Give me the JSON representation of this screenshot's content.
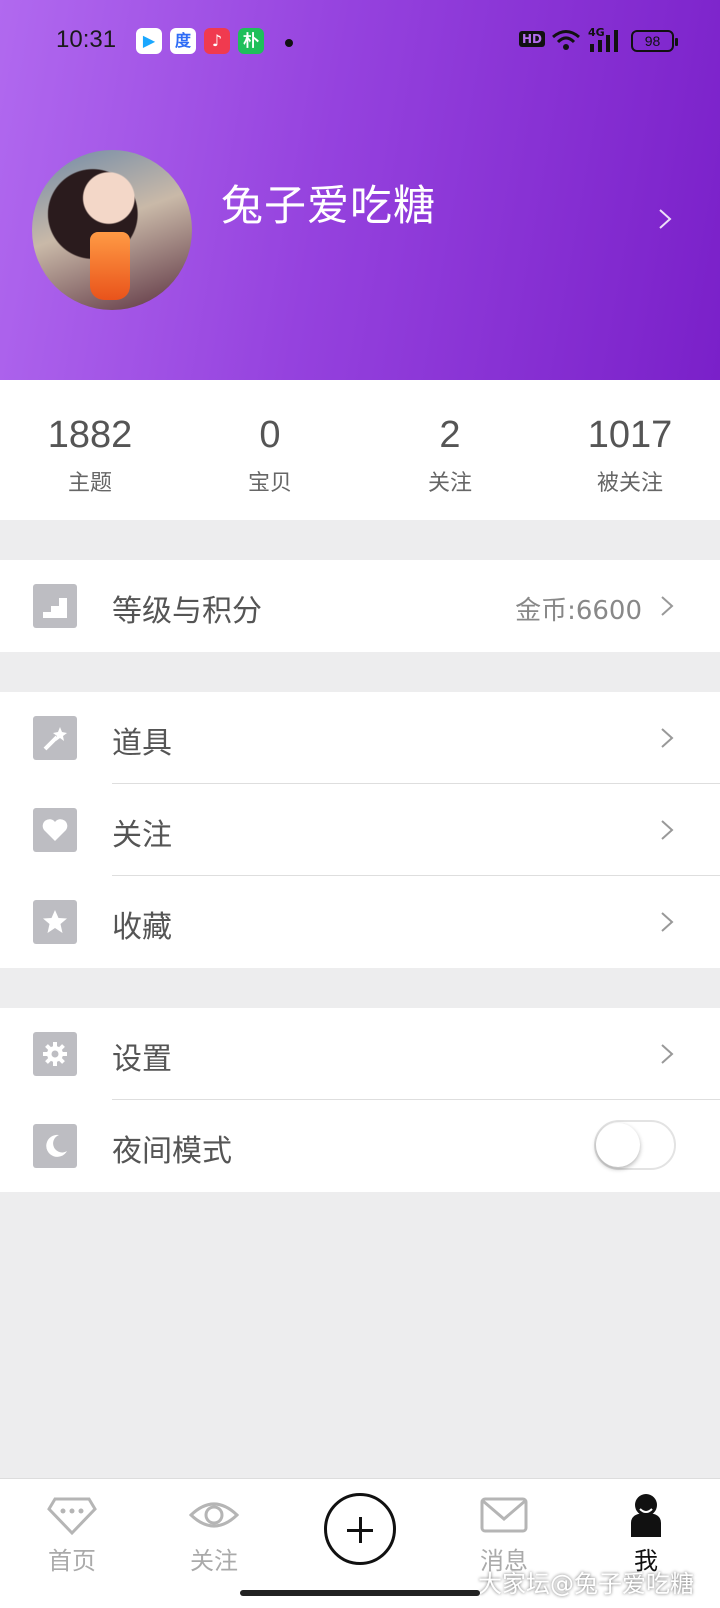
{
  "status_bar": {
    "time": "10:31",
    "hd": "HD",
    "network": "4G",
    "battery": "98",
    "app_icons": [
      {
        "name": "video-app-icon",
        "glyph": "▶",
        "color": "#1aa7ff"
      },
      {
        "name": "baidu-icon",
        "glyph": "度",
        "color": "#2e6cf6"
      },
      {
        "name": "music-icon",
        "glyph": "♪",
        "color": "#f03a4f"
      },
      {
        "name": "pu-app-icon",
        "glyph": "朴",
        "color": "#1fbf5a"
      }
    ]
  },
  "profile": {
    "username": "兔子爱吃糖"
  },
  "stats": [
    {
      "value": "1882",
      "label": "主题"
    },
    {
      "value": "0",
      "label": "宝贝"
    },
    {
      "value": "2",
      "label": "关注"
    },
    {
      "value": "1017",
      "label": "被关注"
    }
  ],
  "menu": {
    "level": {
      "label": "等级与积分",
      "meta": "金币:6600"
    },
    "tools": {
      "label": "道具"
    },
    "follow": {
      "label": "关注"
    },
    "favorites": {
      "label": "收藏"
    },
    "settings": {
      "label": "设置"
    },
    "night_mode": {
      "label": "夜间模式",
      "enabled": false
    }
  },
  "bottom_nav": [
    {
      "label": "首页",
      "icon": "diamond-icon"
    },
    {
      "label": "关注",
      "icon": "eye-icon"
    },
    {
      "label": "",
      "icon": "plus-icon"
    },
    {
      "label": "消息",
      "icon": "mail-icon"
    },
    {
      "label": "我",
      "icon": "user-icon",
      "active": true
    }
  ],
  "watermark": "大家坛@兔子爱吃糖",
  "colors": {
    "header_start": "#b169ef",
    "header_end": "#7a20c9",
    "icon_bg": "#bdbdc2"
  }
}
